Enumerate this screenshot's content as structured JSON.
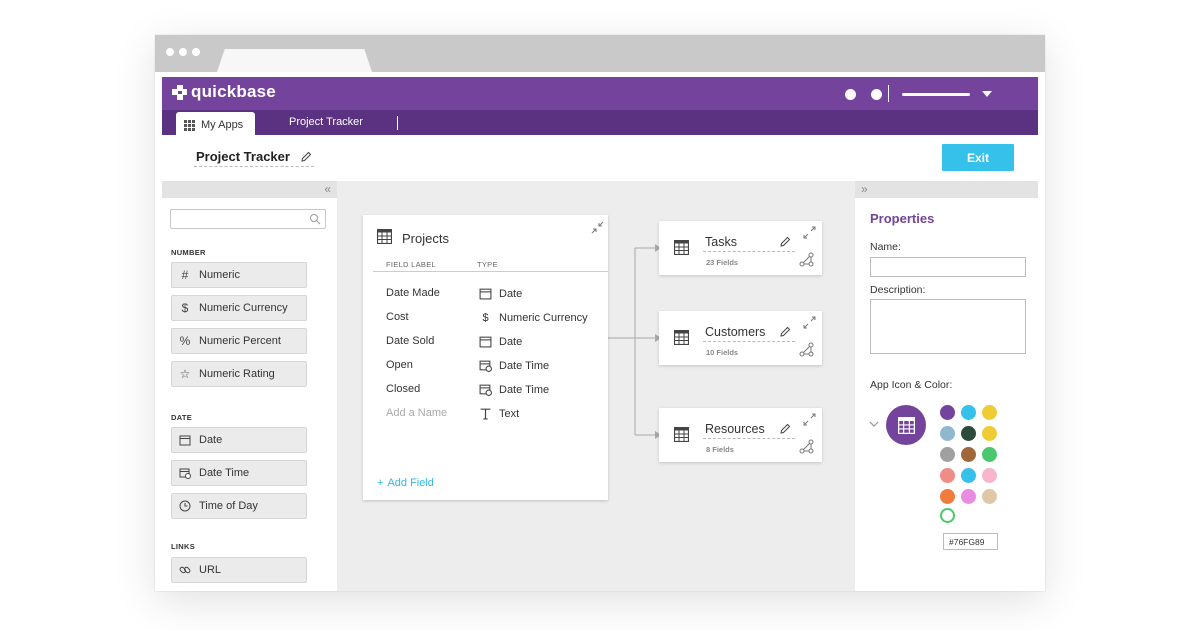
{
  "app": {
    "brand": "quickbase"
  },
  "nav": {
    "tabs": [
      {
        "label": "My Apps"
      },
      {
        "label": "Project Tracker"
      }
    ]
  },
  "page": {
    "title": "Project Tracker",
    "exit_label": "Exit"
  },
  "left_panel": {
    "groups": [
      {
        "label": "NUMBER",
        "items": [
          {
            "label": "Numeric",
            "icon": "hash-icon"
          },
          {
            "label": "Numeric Currency",
            "icon": "dollar-icon"
          },
          {
            "label": "Numeric Percent",
            "icon": "percent-icon"
          },
          {
            "label": "Numeric Rating",
            "icon": "star-icon"
          }
        ]
      },
      {
        "label": "DATE",
        "items": [
          {
            "label": "Date",
            "icon": "calendar-icon"
          },
          {
            "label": "Date Time",
            "icon": "calendar-clock-icon"
          },
          {
            "label": "Time of Day",
            "icon": "clock-icon"
          }
        ]
      },
      {
        "label": "LINKS",
        "items": [
          {
            "label": "URL",
            "icon": "link-icon"
          }
        ]
      }
    ]
  },
  "projects_table": {
    "title": "Projects",
    "col_field_label": "FIELD LABEL",
    "col_type": "TYPE",
    "rows": [
      {
        "label": "Date Made",
        "type": "Date",
        "icon": "calendar-icon"
      },
      {
        "label": "Cost",
        "type": "Numeric Currency",
        "icon": "dollar-icon"
      },
      {
        "label": "Date Sold",
        "type": "Date",
        "icon": "calendar-icon"
      },
      {
        "label": "Open",
        "type": "Date Time",
        "icon": "calendar-clock-icon"
      },
      {
        "label": "Closed",
        "type": "Date Time",
        "icon": "calendar-clock-icon"
      },
      {
        "label": "Add a Name",
        "type": "Text",
        "icon": "text-icon"
      }
    ],
    "add_field_label": "Add Field"
  },
  "related_tables": [
    {
      "title": "Tasks",
      "fields": "23 Fields"
    },
    {
      "title": "Customers",
      "fields": "10 Fields"
    },
    {
      "title": "Resources",
      "fields": "8 Fields"
    }
  ],
  "properties": {
    "title": "Properties",
    "name_label": "Name:",
    "name_value": "",
    "description_label": "Description:",
    "description_value": "",
    "icon_color_label": "App Icon & Color:",
    "hex_value": "#76FG89",
    "accent_color": "#74449c",
    "swatches": [
      [
        "#74449c",
        "#36c1ea",
        "#efcc36"
      ],
      [
        "#8fb8cf",
        "#2d4a3a",
        "#efcc36"
      ],
      [
        "#a0a0a0",
        "#a0683a",
        "#4ac86e"
      ],
      [
        "#ef8c86",
        "#36c1ea",
        "#f7b6cd"
      ],
      [
        "#ef7c3a",
        "#e98be0",
        "#dfc8a8"
      ]
    ],
    "selected_swatch_color": "#4ac86e"
  },
  "colors": {
    "topbar": "#74449c",
    "navbar": "#5b3182",
    "exit": "#36c1ea",
    "link": "#36b5e0"
  }
}
